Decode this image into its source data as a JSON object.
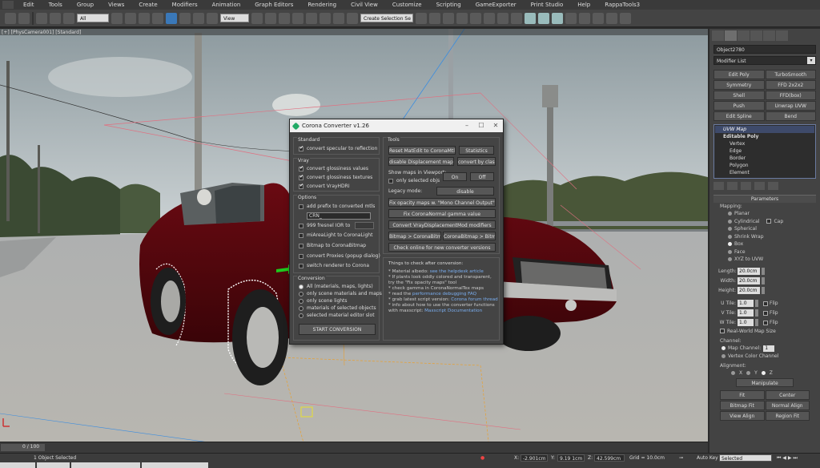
{
  "menu": [
    "Edit",
    "Tools",
    "Group",
    "Views",
    "Create",
    "Modifiers",
    "Animation",
    "Graph Editors",
    "Rendering",
    "Civil View",
    "Customize",
    "Scripting",
    "GameExporter",
    "Print Studio",
    "Help",
    "RappaTools3"
  ],
  "toolbar": {
    "filter_value": "All",
    "view_value": "View",
    "selection_set_placeholder": "Create Selection Se"
  },
  "viewport": {
    "label": "[+] [PhysCamera001] [Standard]"
  },
  "command_panel": {
    "object_name": "Object2780",
    "modifier_list": "Modifier List",
    "modifier_buttons": [
      "Edit Poly",
      "TurboSmooth",
      "Symmetry",
      "FFD 2x2x2",
      "Shell",
      "FFD(box)",
      "Push",
      "Unwrap UVW",
      "Edit Spline",
      "Bend"
    ],
    "stack": {
      "uvw_map": "UVW Map",
      "editable_poly": "Editable Poly",
      "sub_objects": [
        "Vertex",
        "Edge",
        "Border",
        "Polygon",
        "Element"
      ]
    },
    "parameters": {
      "title": "Parameters",
      "mapping_label": "Mapping:",
      "mapping_options": [
        "Planar",
        "Cylindrical",
        "Spherical",
        "Shrink Wrap",
        "Box",
        "Face",
        "XYZ to UVW"
      ],
      "cap_label": "Cap",
      "length_label": "Length:",
      "length_value": "20.0cm",
      "width_label": "Width:",
      "width_value": "20.0cm",
      "height_label": "Height:",
      "height_value": "20.0cm",
      "utile_label": "U Tile:",
      "utile_value": "1.0",
      "vtile_label": "V Tile:",
      "vtile_value": "1.0",
      "wtile_label": "W Tile:",
      "wtile_value": "1.0",
      "flip_label": "Flip",
      "real_world": "Real-World Map Size",
      "channel_label": "Channel:",
      "map_channel": "Map Channel:",
      "map_channel_value": "1",
      "vertex_color_channel": "Vertex Color Channel",
      "alignment_label": "Alignment:",
      "align_x": "X",
      "align_y": "Y",
      "align_z": "Z",
      "manipulate": "Manipulate",
      "fit": "Fit",
      "center": "Center",
      "bitmap_fit": "Bitmap Fit",
      "normal_align": "Normal Align",
      "view_align": "View Align",
      "region_fit": "Region Fit"
    }
  },
  "dialog": {
    "title": "Corona Converter v1.26",
    "standard_label": "Standard",
    "convert_specular": "convert specular to reflection",
    "vray_label": "Vray",
    "convert_glossiness_values": "convert glossiness values",
    "convert_glossiness_textures": "convert glossiness textures",
    "convert_vrayhdri": "convert VrayHDRI",
    "options_label": "Options",
    "add_prefix": "add prefix to converted mtls",
    "prefix_value": "CRN_",
    "fresnel_ior": "999 fresnel IOR to",
    "fresnel_value": "",
    "mi_arealight": "miAreaLight to CoronaLight",
    "bitmap_to_corona": "Bitmap to CoronaBitmap",
    "convert_proxies": "convert Proxies (popup dialog)",
    "switch_renderer": "switch renderer to Corona",
    "conversion_label": "Conversion",
    "conv_options": [
      "All (materials, maps, lights)",
      "only scene materials and maps",
      "only scene lights",
      "materials of selected objects",
      "selected material editor slot"
    ],
    "start_conversion": "START CONVERSION",
    "tools_label": "Tools",
    "reset_mtledit": "Reset MatEdit to CoronaMtls",
    "statistics": "Statistics",
    "disable_displacement": "disable Displacement maps",
    "convert_by_class": "convert by class",
    "show_maps_label": "Show maps in Viewport:",
    "on_label": "On",
    "off_label": "Off",
    "only_selected": "only selected objs",
    "legacy_mode_label": "Legacy mode:",
    "legacy_disable": "disable",
    "fix_opacity": "Fix opacity maps w. \"Mono Channel Output\" on",
    "fix_corona_normal": "Fix CoronaNormal gamma value",
    "convert_vray_disp": "Convert VrayDisplacementMod modifiers",
    "bitmap_to_coronabitmap": "Bitmap > CoronaBitmap",
    "coronabitmap_to_bitmap": "CoronaBitmap > Bitmap",
    "check_online": "Check online for new converter versions",
    "things_label": "Things to check after conversion:",
    "notes": {
      "n1_text": "* Material albedo: ",
      "n1_link": "see the helpdesk article",
      "n2": "* If plants look oddly colored and transparent,",
      "n3": "   try the \"Fix opacity maps\" tool",
      "n4": "* check gamma in CoronaNormalTex maps",
      "n5_text": "* read the ",
      "n5_link": "performance debugging FAQ",
      "n6_text": "* grab latest script version: ",
      "n6_link": "Corona forum thread",
      "n7": "* info about how to use the converter functions",
      "n8_text": "   with maxscript: ",
      "n8_link": "Maxscript Documentation"
    }
  },
  "timeline": {
    "frame": "0 / 100"
  },
  "status": {
    "selected": "1 Object Selected",
    "x_label": "X:",
    "x_value": "-2.901cm",
    "y_label": "Y:",
    "y_value": "9.19 1cm",
    "z_label": "Z:",
    "z_value": "42.599cm",
    "grid": "Grid = 10.0cm",
    "autokey": "Auto Key",
    "selected_dropdown": "Selected"
  }
}
